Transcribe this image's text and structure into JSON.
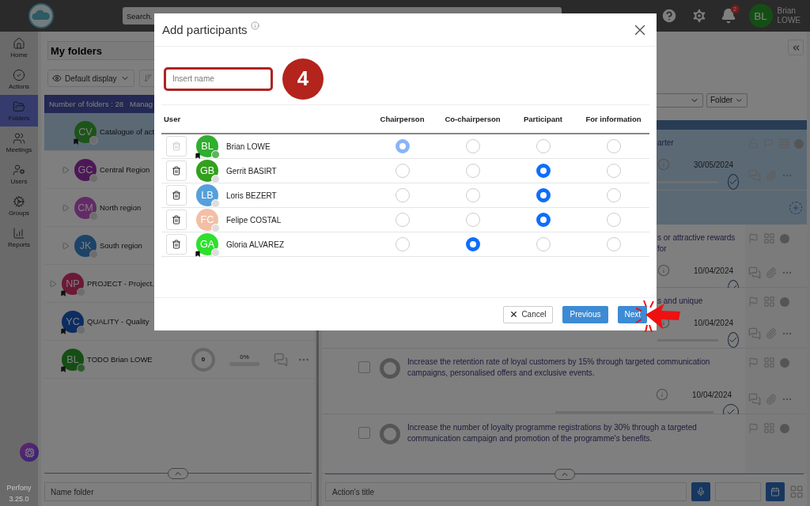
{
  "topbar": {
    "search_placeholder": "Search.",
    "notifications": "2",
    "user": {
      "initials": "BL",
      "first_name": "Brian",
      "last_name": "LOWE"
    }
  },
  "sidebar": {
    "items": [
      {
        "label": "Home",
        "selected": false
      },
      {
        "label": "Actions",
        "selected": false
      },
      {
        "label": "Folders",
        "selected": true
      },
      {
        "label": "Meetings",
        "selected": false
      },
      {
        "label": "Users",
        "selected": false
      },
      {
        "label": "Groups",
        "selected": false
      },
      {
        "label": "Reports",
        "selected": false
      }
    ],
    "app_name": "Perfony",
    "version": "3.25.0"
  },
  "folders_panel": {
    "title": "My folders",
    "display": "Default display",
    "summary": "Number of folders : 28",
    "manage": "Manag",
    "subfolders": [
      {
        "initials": "CV",
        "name": "Catalogue of act",
        "color": "#1d5419",
        "expandable": false,
        "bookmarked": true,
        "online": false,
        "selected": true
      },
      {
        "initials": "GC",
        "name": "Central Region",
        "color": "#4d1757",
        "expandable": true,
        "bookmarked": false,
        "online": false,
        "selected": false
      },
      {
        "initials": "CM",
        "name": "North region",
        "color": "#642a66",
        "expandable": true,
        "bookmarked": false,
        "online": false,
        "selected": false
      },
      {
        "initials": "JK",
        "name": "South region",
        "color": "#1d4368",
        "expandable": true,
        "bookmarked": false,
        "online": false,
        "selected": false
      }
    ],
    "folders": [
      {
        "initials": "NP",
        "name": "PROJECT - Project.",
        "color": "#6b1936",
        "expandable": true,
        "bookmarked": true,
        "online": false,
        "selected": false
      },
      {
        "initials": "YC",
        "name": "QUALITY - Quality",
        "color": "#0d2d62",
        "expandable": false,
        "bookmarked": true,
        "online": false,
        "selected": false
      },
      {
        "initials": "BL",
        "name": "TODO Brian LOWE",
        "color": "#154e15",
        "expandable": false,
        "bookmarked": true,
        "online": true,
        "selected": false,
        "count": "0",
        "percent": "0%",
        "level": 0
      }
    ],
    "name_placeholder": "Name folder"
  },
  "actions_panel": {
    "filter": "Folder",
    "actions": [
      {
        "kind": "clipped",
        "text": "arter",
        "date": "30/05/2024",
        "selected": true,
        "locked": true
      },
      {
        "kind": "clipped",
        "text": "s or attractive rewards for",
        "date": "10/04/2024",
        "selected": false,
        "locked": false
      },
      {
        "kind": "clipped",
        "text": "s and unique",
        "date": "10/04/2024",
        "selected": false,
        "locked": false
      },
      {
        "kind": "full",
        "text": "Increase the retention rate of loyal customers by 15% through targeted communication campaigns, personalised offers and exclusive events.",
        "date": "10/04/2024",
        "selected": false,
        "locked": false
      },
      {
        "kind": "full",
        "text": "Increase the number of loyalty programme registrations by 30% through a targeted communication campaign and promotion of the programme's benefits.",
        "selected": false,
        "locked": false
      }
    ],
    "title_placeholder": "Action's title"
  },
  "modal": {
    "title": "Add participants",
    "search_placeholder": "Insert name",
    "step_badge": "4",
    "columns": [
      "User",
      "Chairperson",
      "Co-chairperson",
      "Participant",
      "For information"
    ],
    "participants": [
      {
        "initials": "BL",
        "name": "Brian LOWE",
        "color": "#2fae2f",
        "bookmarked": true,
        "online": true,
        "locked": true,
        "roles": [
          {
            "selected": true
          },
          {
            "selected": false
          },
          {
            "selected": false
          },
          {
            "selected": false
          }
        ]
      },
      {
        "initials": "GB",
        "name": "Gerrit BASIRT",
        "color": "#33a01e",
        "bookmarked": false,
        "online": false,
        "locked": false,
        "roles": [
          {
            "selected": false
          },
          {
            "selected": false
          },
          {
            "selected": true
          },
          {
            "selected": false
          }
        ]
      },
      {
        "initials": "LB",
        "name": "Loris BEZERT",
        "color": "#55a0db",
        "bookmarked": false,
        "online": false,
        "locked": false,
        "roles": [
          {
            "selected": false
          },
          {
            "selected": false
          },
          {
            "selected": true
          },
          {
            "selected": false
          }
        ]
      },
      {
        "initials": "FC",
        "name": "Felipe COSTAL",
        "color": "#f2bfa6",
        "bookmarked": false,
        "online": false,
        "locked": false,
        "roles": [
          {
            "selected": false
          },
          {
            "selected": false
          },
          {
            "selected": true
          },
          {
            "selected": false
          }
        ]
      },
      {
        "initials": "GA",
        "name": "Gloria ALVAREZ",
        "color": "#2ee02e",
        "bookmarked": true,
        "online": false,
        "locked": false,
        "roles": [
          {
            "selected": false
          },
          {
            "selected": true
          },
          {
            "selected": false
          },
          {
            "selected": false
          }
        ]
      }
    ],
    "buttons": {
      "cancel": "Cancel",
      "previous": "Previous",
      "next": "Next"
    }
  }
}
